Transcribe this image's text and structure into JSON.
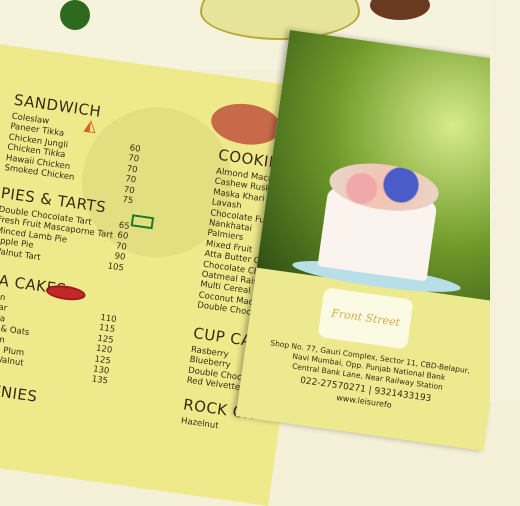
{
  "sandwich": {
    "title": "SANDWICH",
    "items": [
      "Coleslaw",
      "Paneer Tikka",
      "Chicken Jungli",
      "Chicken Tikka",
      "Hawaii Chicken",
      "Smoked Chicken"
    ],
    "prices": [
      "60",
      "70",
      "70",
      "70",
      "70",
      "75"
    ]
  },
  "pies": {
    "title": "PIES & TARTS",
    "items": [
      "Double Chocolate Tart",
      "Fresh Fruit Mascaporne Tart",
      "Minced Lamb Pie",
      "Apple Pie",
      "Walnut Tart"
    ],
    "prices": [
      "65",
      "60",
      "70",
      "90",
      "105"
    ]
  },
  "teacakes": {
    "title": "EA CAKES",
    "items": [
      "mon",
      "k Bar",
      "deira",
      "ana & Oats",
      "amon",
      "nium Plum",
      "s & Walnut"
    ],
    "prices": [
      "110",
      "115",
      "125",
      "120",
      "125",
      "130",
      "135"
    ]
  },
  "brownies": {
    "title": "OWNIES"
  },
  "cookies": {
    "title": "COOKIES",
    "items": [
      "Almond Macroo",
      "Cashew Rusk",
      "Maska Khari",
      "Lavash",
      "Chocolate Fudg",
      "Nankhatai",
      "Palmiers",
      "Mixed Fruit",
      "Atta Butter Coo",
      "Chocolate Chip",
      "Oatmeal Raisin",
      "Multi Cereal Co",
      "Coconut Macro",
      "Double Chocol"
    ]
  },
  "cupcakes": {
    "title": "CUP CAK",
    "items": [
      "Rasberry",
      "Blueberry",
      "Double Choco",
      "Red Velvette"
    ]
  },
  "rock": {
    "title": "ROCK CH",
    "items": [
      "Hazelnut"
    ]
  },
  "brand": "Front Street",
  "address": {
    "line1": "Shop No. 77, Gauri Complex, Sector 11, CBD-Belapur,",
    "line2": "Navi Mumbai, Opp. Punjab National Bank",
    "line3": "Central Bank Lane, Near Railway Station",
    "phone": "022-27570271 | 9321433193",
    "web": "www.leisurefo"
  }
}
